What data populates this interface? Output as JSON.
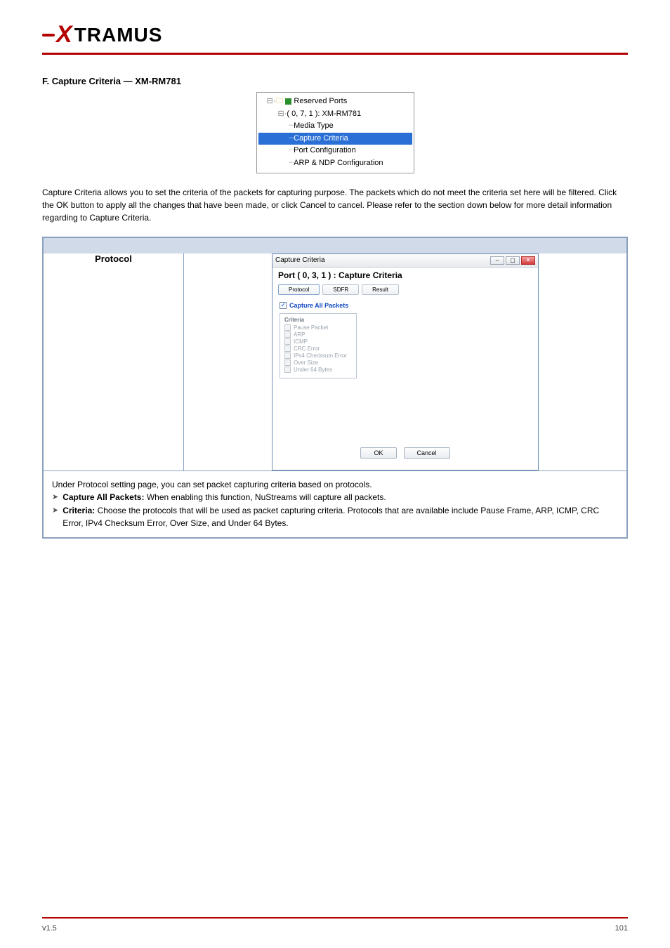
{
  "brand": {
    "name": "TRAMUS"
  },
  "section": {
    "heading": "F. Capture Criteria — XM-RM781",
    "intro": "Capture Criteria allows you to set the criteria of the packets for capturing purpose. The packets which do not meet the criteria set here will be filtered. Click the OK button to apply all the changes that have been made, or click Cancel to cancel. Please refer to the section down below for more detail information regarding to Capture Criteria."
  },
  "tree": {
    "reserved_ports": "Reserved Ports",
    "module": "( 0, 7, 1 ): XM-RM781",
    "media_type": "Media Type",
    "capture_criteria": "Capture Criteria",
    "port_configuration": "Port Configuration",
    "arp_ndp": "ARP & NDP Configuration"
  },
  "dialog": {
    "window_title": "Capture Criteria",
    "subtitle": "Port ( 0, 3, 1 ) : Capture Criteria",
    "tabs": [
      "Protocol",
      "SDFR",
      "Result"
    ],
    "capture_all": "Capture All Packets",
    "criteria_legend": "Criteria",
    "criteria": [
      "Pause Packet",
      "ARP",
      "ICMP",
      "CRC Error",
      "IPv4 Checksum Error",
      "Over Size",
      "Under 64 Bytes"
    ],
    "ok": "OK",
    "cancel": "Cancel"
  },
  "table": {
    "protocol_label": "Protocol",
    "protocol_desc_intro": "Under Protocol setting page, you can set packet capturing criteria based on protocols.",
    "bullets": [
      {
        "title": "Capture All Packets:",
        "text": "When enabling this function, NuStreams will capture all packets."
      },
      {
        "title": "Criteria:",
        "text": "Choose the protocols that will be used as packet capturing criteria. Protocols that are available include Pause Frame, ARP, ICMP, CRC Error, IPv4 Checksum Error, Over Size, and Under 64 Bytes."
      }
    ]
  },
  "footer": {
    "left": "v1.5",
    "right": "101"
  }
}
